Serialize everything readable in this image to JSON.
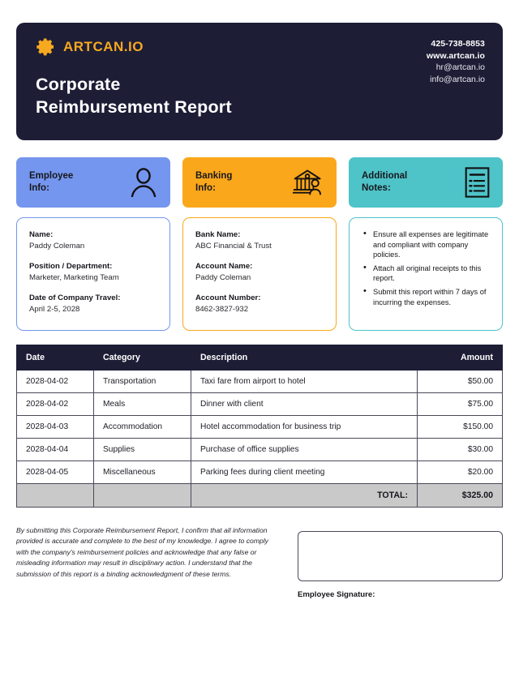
{
  "header": {
    "logo_text": "ARTCAN.IO",
    "logo_icon": "gear-icon",
    "logo_color": "#f7a91f",
    "background": "#1d1d36",
    "title_line1": "Corporate",
    "title_line2": "Reimbursement Report",
    "contact": {
      "phone": "425-738-8853",
      "website": "www.artcan.io",
      "email_hr": "hr@artcan.io",
      "email_info": "info@artcan.io"
    }
  },
  "cards": [
    {
      "label_line1": "Employee",
      "label_line2": "Info:",
      "icon": "person-icon",
      "color": "#7596ee"
    },
    {
      "label_line1": "Banking",
      "label_line2": "Info:",
      "icon": "bank-icon",
      "color": "#fba71b"
    },
    {
      "label_line1": "Additional",
      "label_line2": "Notes:",
      "icon": "document-list-icon",
      "color": "#4ec3c8"
    }
  ],
  "employee_info": {
    "border_color": "#7596ee",
    "fields": [
      {
        "label": "Name:",
        "value": "Paddy Coleman"
      },
      {
        "label": "Position / Department:",
        "value": "Marketer, Marketing Team"
      },
      {
        "label": "Date of Company Travel:",
        "value": "April 2-5, 2028"
      }
    ]
  },
  "banking_info": {
    "border_color": "#fba71b",
    "fields": [
      {
        "label": "Bank Name:",
        "value": "ABC Financial & Trust"
      },
      {
        "label": "Account Name:",
        "value": "Paddy Coleman"
      },
      {
        "label": "Account Number:",
        "value": "8462-3827-932"
      }
    ]
  },
  "additional_notes": {
    "border_color": "#4ec3c8",
    "items": [
      "Ensure all expenses are legitimate and compliant with company policies.",
      "Attach all original receipts to this report.",
      "Submit this report within 7 days of incurring the expenses."
    ]
  },
  "expense_table": {
    "columns": [
      "Date",
      "Category",
      "Description",
      "Amount"
    ],
    "rows": [
      {
        "date": "2028-04-02",
        "category": "Transportation",
        "description": "Taxi fare from airport to hotel",
        "amount": "$50.00"
      },
      {
        "date": "2028-04-02",
        "category": "Meals",
        "description": "Dinner with client",
        "amount": "$75.00"
      },
      {
        "date": "2028-04-03",
        "category": "Accommodation",
        "description": "Hotel accommodation for business trip",
        "amount": "$150.00"
      },
      {
        "date": "2028-04-04",
        "category": "Supplies",
        "description": "Purchase of office supplies",
        "amount": "$30.00"
      },
      {
        "date": "2028-04-05",
        "category": "Miscellaneous",
        "description": "Parking fees during client meeting",
        "amount": "$20.00"
      }
    ],
    "total_label": "TOTAL:",
    "total_amount": "$325.00"
  },
  "footer": {
    "disclaimer": "By submitting this Corporate Reimbursement Report, I confirm that all information provided is accurate and complete to the best of my knowledge. I agree to comply with the company's reimbursement policies and acknowledge that any false or misleading information may result in disciplinary action. I understand that the submission of this report is a binding acknowledgment of these terms.",
    "signature_label": "Employee Signature:"
  }
}
